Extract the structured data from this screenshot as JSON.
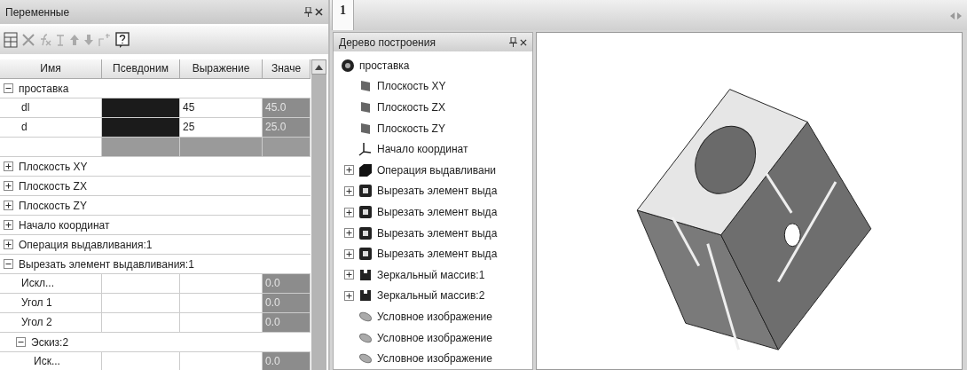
{
  "variables_panel": {
    "title": "Переменные",
    "columns": [
      "Имя",
      "Псевдоним",
      "Выражение",
      "Значе"
    ],
    "rows": [
      {
        "kind": "group",
        "label": "проставка",
        "expanded": true,
        "children": [
          {
            "kind": "var",
            "name": "dl",
            "alias_filled": true,
            "expression": "45",
            "value": "45.0"
          },
          {
            "kind": "var",
            "name": "d",
            "alias_filled": true,
            "expression": "25",
            "value": "25.0"
          },
          {
            "kind": "blank"
          }
        ]
      },
      {
        "kind": "group",
        "label": "Плоскость XY",
        "expanded": false
      },
      {
        "kind": "group",
        "label": "Плоскость ZX",
        "expanded": false
      },
      {
        "kind": "group",
        "label": "Плоскость ZY",
        "expanded": false
      },
      {
        "kind": "group",
        "label": "Начало координат",
        "expanded": false
      },
      {
        "kind": "group",
        "label": "Операция выдавливания:1",
        "expanded": false
      },
      {
        "kind": "group",
        "label": "Вырезать элемент выдавливания:1",
        "expanded": true,
        "children": [
          {
            "kind": "var",
            "name": "Искл...",
            "alias_filled": false,
            "value": "0.0"
          },
          {
            "kind": "var",
            "name": "Угол 1",
            "alias_filled": false,
            "value": "0.0"
          },
          {
            "kind": "var",
            "name": "Угол 2",
            "alias_filled": false,
            "value": "0.0"
          },
          {
            "kind": "group",
            "label": "Эскиз:2",
            "expanded": true,
            "children": [
              {
                "kind": "var",
                "name": "Иск...",
                "alias_filled": false,
                "value": "0.0"
              }
            ]
          }
        ]
      }
    ]
  },
  "document_tabs": [
    {
      "label": "1",
      "selected": true
    }
  ],
  "tree_panel": {
    "title": "Дерево построения",
    "root": {
      "label": "проставка",
      "kind": "part"
    },
    "items": [
      {
        "label": "Плоскость XY",
        "kind": "plane",
        "expandable": false
      },
      {
        "label": "Плоскость ZX",
        "kind": "plane",
        "expandable": false
      },
      {
        "label": "Плоскость ZY",
        "kind": "plane",
        "expandable": false
      },
      {
        "label": "Начало координат",
        "kind": "origin",
        "expandable": false
      },
      {
        "label": "Операция выдавливани",
        "kind": "extrude",
        "expandable": true
      },
      {
        "label": "Вырезать элемент выда",
        "kind": "cut",
        "expandable": true
      },
      {
        "label": "Вырезать элемент выда",
        "kind": "cut",
        "expandable": true
      },
      {
        "label": "Вырезать элемент выда",
        "kind": "cut",
        "expandable": true
      },
      {
        "label": "Вырезать элемент выда",
        "kind": "cut",
        "expandable": true
      },
      {
        "label": "Зеркальный массив:1",
        "kind": "mirror",
        "expandable": true
      },
      {
        "label": "Зеркальный массив:2",
        "kind": "mirror",
        "expandable": true
      },
      {
        "label": "Условное изображение",
        "kind": "thread",
        "expandable": false
      },
      {
        "label": "Условное изображение",
        "kind": "thread",
        "expandable": false
      },
      {
        "label": "Условное изображение",
        "kind": "thread",
        "expandable": false
      }
    ]
  }
}
